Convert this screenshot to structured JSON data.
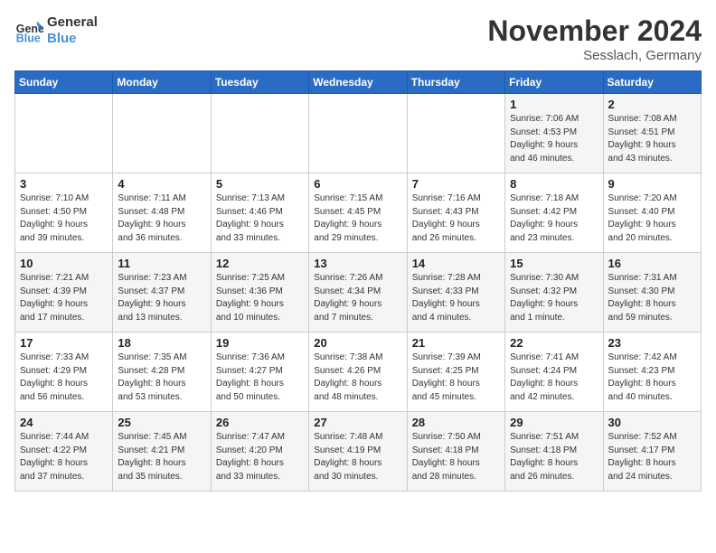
{
  "logo": {
    "line1": "General",
    "line2": "Blue"
  },
  "title": "November 2024",
  "subtitle": "Sesslach, Germany",
  "days_of_week": [
    "Sunday",
    "Monday",
    "Tuesday",
    "Wednesday",
    "Thursday",
    "Friday",
    "Saturday"
  ],
  "weeks": [
    [
      {
        "day": "",
        "info": ""
      },
      {
        "day": "",
        "info": ""
      },
      {
        "day": "",
        "info": ""
      },
      {
        "day": "",
        "info": ""
      },
      {
        "day": "",
        "info": ""
      },
      {
        "day": "1",
        "info": "Sunrise: 7:06 AM\nSunset: 4:53 PM\nDaylight: 9 hours\nand 46 minutes."
      },
      {
        "day": "2",
        "info": "Sunrise: 7:08 AM\nSunset: 4:51 PM\nDaylight: 9 hours\nand 43 minutes."
      }
    ],
    [
      {
        "day": "3",
        "info": "Sunrise: 7:10 AM\nSunset: 4:50 PM\nDaylight: 9 hours\nand 39 minutes."
      },
      {
        "day": "4",
        "info": "Sunrise: 7:11 AM\nSunset: 4:48 PM\nDaylight: 9 hours\nand 36 minutes."
      },
      {
        "day": "5",
        "info": "Sunrise: 7:13 AM\nSunset: 4:46 PM\nDaylight: 9 hours\nand 33 minutes."
      },
      {
        "day": "6",
        "info": "Sunrise: 7:15 AM\nSunset: 4:45 PM\nDaylight: 9 hours\nand 29 minutes."
      },
      {
        "day": "7",
        "info": "Sunrise: 7:16 AM\nSunset: 4:43 PM\nDaylight: 9 hours\nand 26 minutes."
      },
      {
        "day": "8",
        "info": "Sunrise: 7:18 AM\nSunset: 4:42 PM\nDaylight: 9 hours\nand 23 minutes."
      },
      {
        "day": "9",
        "info": "Sunrise: 7:20 AM\nSunset: 4:40 PM\nDaylight: 9 hours\nand 20 minutes."
      }
    ],
    [
      {
        "day": "10",
        "info": "Sunrise: 7:21 AM\nSunset: 4:39 PM\nDaylight: 9 hours\nand 17 minutes."
      },
      {
        "day": "11",
        "info": "Sunrise: 7:23 AM\nSunset: 4:37 PM\nDaylight: 9 hours\nand 13 minutes."
      },
      {
        "day": "12",
        "info": "Sunrise: 7:25 AM\nSunset: 4:36 PM\nDaylight: 9 hours\nand 10 minutes."
      },
      {
        "day": "13",
        "info": "Sunrise: 7:26 AM\nSunset: 4:34 PM\nDaylight: 9 hours\nand 7 minutes."
      },
      {
        "day": "14",
        "info": "Sunrise: 7:28 AM\nSunset: 4:33 PM\nDaylight: 9 hours\nand 4 minutes."
      },
      {
        "day": "15",
        "info": "Sunrise: 7:30 AM\nSunset: 4:32 PM\nDaylight: 9 hours\nand 1 minute."
      },
      {
        "day": "16",
        "info": "Sunrise: 7:31 AM\nSunset: 4:30 PM\nDaylight: 8 hours\nand 59 minutes."
      }
    ],
    [
      {
        "day": "17",
        "info": "Sunrise: 7:33 AM\nSunset: 4:29 PM\nDaylight: 8 hours\nand 56 minutes."
      },
      {
        "day": "18",
        "info": "Sunrise: 7:35 AM\nSunset: 4:28 PM\nDaylight: 8 hours\nand 53 minutes."
      },
      {
        "day": "19",
        "info": "Sunrise: 7:36 AM\nSunset: 4:27 PM\nDaylight: 8 hours\nand 50 minutes."
      },
      {
        "day": "20",
        "info": "Sunrise: 7:38 AM\nSunset: 4:26 PM\nDaylight: 8 hours\nand 48 minutes."
      },
      {
        "day": "21",
        "info": "Sunrise: 7:39 AM\nSunset: 4:25 PM\nDaylight: 8 hours\nand 45 minutes."
      },
      {
        "day": "22",
        "info": "Sunrise: 7:41 AM\nSunset: 4:24 PM\nDaylight: 8 hours\nand 42 minutes."
      },
      {
        "day": "23",
        "info": "Sunrise: 7:42 AM\nSunset: 4:23 PM\nDaylight: 8 hours\nand 40 minutes."
      }
    ],
    [
      {
        "day": "24",
        "info": "Sunrise: 7:44 AM\nSunset: 4:22 PM\nDaylight: 8 hours\nand 37 minutes."
      },
      {
        "day": "25",
        "info": "Sunrise: 7:45 AM\nSunset: 4:21 PM\nDaylight: 8 hours\nand 35 minutes."
      },
      {
        "day": "26",
        "info": "Sunrise: 7:47 AM\nSunset: 4:20 PM\nDaylight: 8 hours\nand 33 minutes."
      },
      {
        "day": "27",
        "info": "Sunrise: 7:48 AM\nSunset: 4:19 PM\nDaylight: 8 hours\nand 30 minutes."
      },
      {
        "day": "28",
        "info": "Sunrise: 7:50 AM\nSunset: 4:18 PM\nDaylight: 8 hours\nand 28 minutes."
      },
      {
        "day": "29",
        "info": "Sunrise: 7:51 AM\nSunset: 4:18 PM\nDaylight: 8 hours\nand 26 minutes."
      },
      {
        "day": "30",
        "info": "Sunrise: 7:52 AM\nSunset: 4:17 PM\nDaylight: 8 hours\nand 24 minutes."
      }
    ]
  ]
}
